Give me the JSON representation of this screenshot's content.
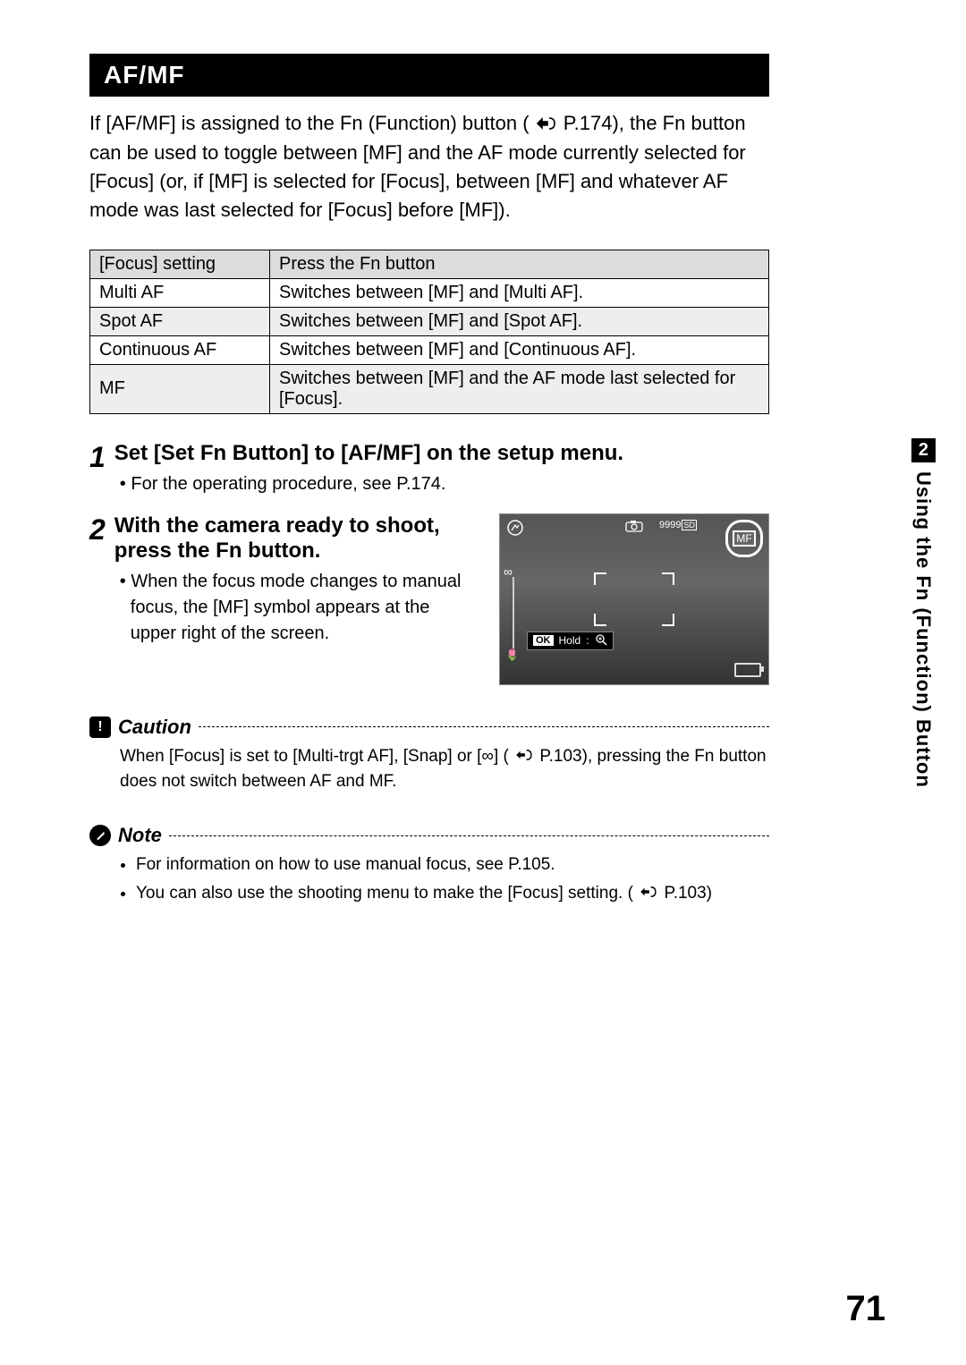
{
  "header": {
    "title": "AF/MF"
  },
  "intro": {
    "text_a": "If [AF/MF] is assigned to the Fn (Function) button (",
    "page_ref_1": "P.174",
    "text_b": "), the Fn button can be used to toggle between [MF] and the AF mode currently selected for [Focus] (or, if [MF] is selected for [Focus], between [MF] and whatever AF mode was last selected for [Focus] before [MF])."
  },
  "table": {
    "col1": "[Focus] setting",
    "col2": "Press the Fn button",
    "rows": [
      {
        "focus": "Multi AF",
        "action": "Switches between [MF] and [Multi AF]."
      },
      {
        "focus": "Spot AF",
        "action": "Switches between [MF] and [Spot AF]."
      },
      {
        "focus": "Continuous AF",
        "action": "Switches between [MF] and [Continuous AF]."
      },
      {
        "focus": "MF",
        "action": "Switches between [MF] and the AF mode last selected for [Focus]."
      }
    ]
  },
  "steps": {
    "s1": {
      "num": "1",
      "heading": "Set [Set Fn Button] to [AF/MF] on the setup menu.",
      "bullet": "For the operating procedure, see P.174."
    },
    "s2": {
      "num": "2",
      "heading": "With the camera ready to shoot, press the Fn button.",
      "bullet": "When the focus mode changes to manual focus, the [MF] symbol appears at the upper right of the screen."
    }
  },
  "camera": {
    "mf_label": "MF",
    "count": "9999",
    "sd": "SD",
    "ok": "OK",
    "hold": "Hold",
    "inf": "∞"
  },
  "caution": {
    "title": "Caution",
    "body_a": "When [Focus] is set to [Multi-trgt AF], [Snap] or [∞] (",
    "page_ref": "P.103",
    "body_b": "), pressing the Fn button does not switch between AF and MF."
  },
  "note": {
    "title": "Note",
    "b1": "For information on how to use manual focus, see P.105.",
    "b2_a": "You can also use the shooting menu to make the [Focus] setting. (",
    "b2_ref": "P.103",
    "b2_b": ")"
  },
  "side": {
    "chapter": "2",
    "label": "Using the Fn (Function) Button"
  },
  "page_number": "71"
}
